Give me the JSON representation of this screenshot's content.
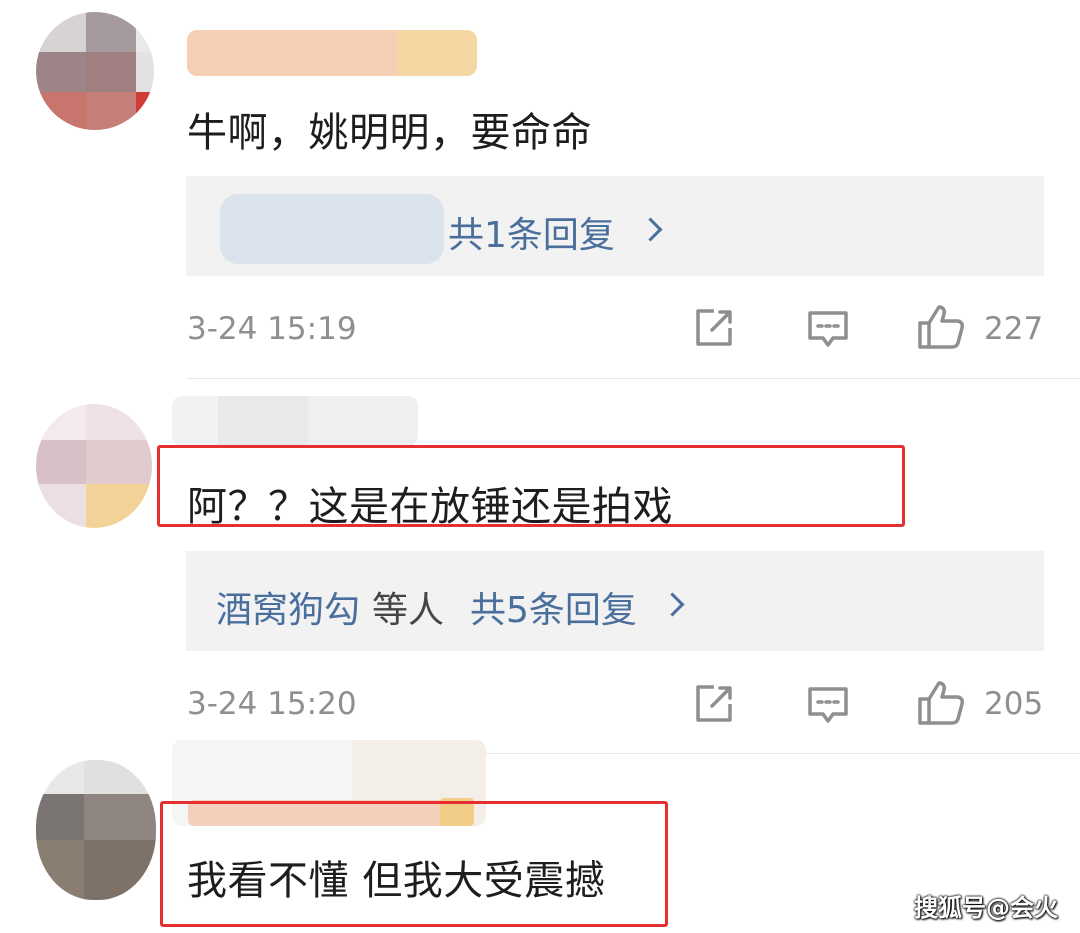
{
  "comments": [
    {
      "text": "牛啊，姚明明，要命命",
      "reply": {
        "names": "",
        "others": "",
        "count_label": "共1条回复"
      },
      "time": "3-24 15:19",
      "likes": "227",
      "icons": {
        "share": "share-edit-icon",
        "comment": "comment-bubble-icon",
        "like": "thumbs-up-icon"
      }
    },
    {
      "text": "阿？？这是在放锤还是拍戏",
      "reply": {
        "names": "酒窝狗勾",
        "others": "等人",
        "count_label": "共5条回复"
      },
      "time": "3-24 15:20",
      "likes": "205",
      "icons": {
        "share": "share-edit-icon",
        "comment": "comment-bubble-icon",
        "like": "thumbs-up-icon"
      }
    },
    {
      "text": "我看不懂 但我大受震撼"
    }
  ],
  "watermark": "搜狐号@会火",
  "colors": {
    "link_blue": "#4a6f9c",
    "highlight_red": "#e5302f",
    "meta_gray": "#8f8f8f",
    "reply_bg": "#f2f2f2"
  }
}
